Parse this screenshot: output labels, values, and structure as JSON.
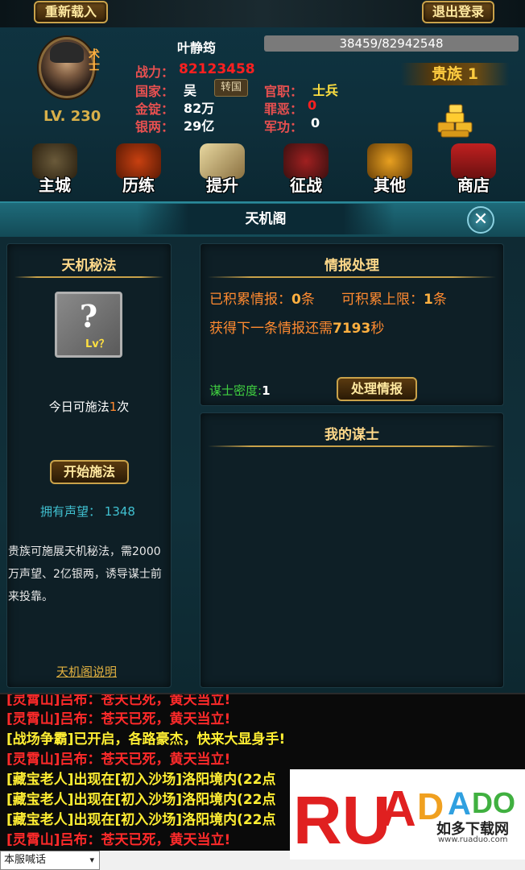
{
  "top": {
    "reload_label": "重新载入",
    "logout_label": "退出登录"
  },
  "player": {
    "name": "叶静筠",
    "avatar_tag": "术士",
    "level": "LV. 230",
    "exp": "38459/82942548",
    "power_label": "战力：",
    "power_value": "82123458",
    "country_label": "国家：",
    "country_value": "吴",
    "transfer_label": "转国",
    "gold_label": "金锭：",
    "gold_value": "82万",
    "silver_label": "银两：",
    "silver_value": "29亿",
    "rank_label": "官职：",
    "rank_value": "士兵",
    "crime_label": "罪恶：",
    "crime_value": "0",
    "merit_label": "军功：",
    "merit_value": "0",
    "noble": "贵族 1"
  },
  "nav": [
    {
      "label": "主城",
      "icon": "castle-icon"
    },
    {
      "label": "历练",
      "icon": "helmet-icon"
    },
    {
      "label": "提升",
      "icon": "scroll-icon"
    },
    {
      "label": "征战",
      "icon": "battle-icon"
    },
    {
      "label": "其他",
      "icon": "lion-icon"
    },
    {
      "label": "商店",
      "icon": "pagoda-icon"
    }
  ],
  "panel": {
    "title": "天机阁"
  },
  "left": {
    "title": "天机秘法",
    "mystery_q": "?",
    "mystery_lv": "Lv？",
    "today_prefix": "今日可施法",
    "today_count": "1",
    "today_suffix": "次",
    "start_label": "开始施法",
    "reputation_label": "拥有声望：",
    "reputation_value": "1348",
    "desc_line1": "贵族可施展天机秘法，需2000",
    "desc_line2": "万声望、2亿银两，诱导谋士前",
    "desc_line3": "来投靠。",
    "help_link": "天机阁说明"
  },
  "intel": {
    "title": "情报处理",
    "accum_label": "已积累情报：",
    "accum_value": "0",
    "accum_unit": "条",
    "limit_label": "可积累上限：",
    "limit_value": "1",
    "limit_unit": "条",
    "next_prefix": "获得下一条情报还需",
    "next_value": "7193",
    "next_unit": "秒",
    "density_label": "谋士密度:",
    "density_value": "1",
    "process_label": "处理情报"
  },
  "advisors": {
    "title": "我的谋士"
  },
  "chat": {
    "lines": [
      {
        "text": "[灵霄山]吕布：苍天已死，黄天当立!",
        "color": "#ff2a2a"
      },
      {
        "text": "[灵霄山]吕布：苍天已死，黄天当立!",
        "color": "#ff2a2a"
      },
      {
        "text": "[战场争霸]已开启，各路豪杰，快来大显身手!",
        "color": "#ffee33"
      },
      {
        "text": "[灵霄山]吕布：苍天已死，黄天当立!",
        "color": "#ff2a2a"
      },
      {
        "text": "[藏宝老人]出现在[初入沙场]洛阳境内(22点",
        "color": "#ffee33"
      },
      {
        "text": "[藏宝老人]出现在[初入沙场]洛阳境内(22点",
        "color": "#ffee33"
      },
      {
        "text": "[藏宝老人]出现在[初入沙场]洛阳境内(22点",
        "color": "#ffee33"
      },
      {
        "text": "[灵霄山]吕布：苍天已死，黄天当立!",
        "color": "#ff2a2a"
      }
    ],
    "channel": "本服喊话"
  },
  "watermark": {
    "logo": "RUANDAO",
    "cn": "如多下载网",
    "url": "www.ruaduo.com"
  }
}
